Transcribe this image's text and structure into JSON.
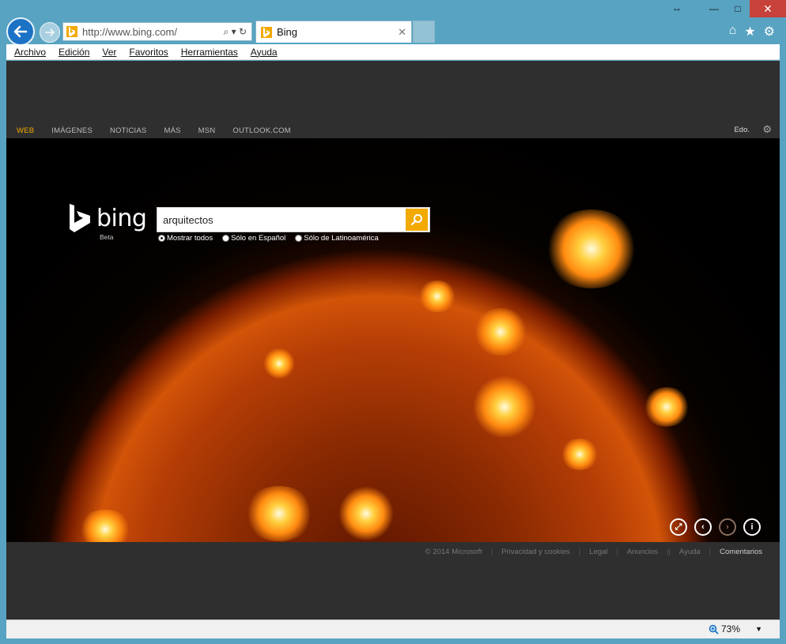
{
  "window": {
    "caption": {
      "resize": "↔",
      "minimize": "—",
      "maximize": "□",
      "close": "✕"
    }
  },
  "addressbar": {
    "url": "http://www.bing.com/",
    "tools": "⌕ ▾ ↻"
  },
  "tab": {
    "title": "Bing",
    "close": "✕"
  },
  "toolbar_icons": {
    "home": "⌂",
    "favorites": "★",
    "settings": "⚙"
  },
  "menu": [
    "Archivo",
    "Edición",
    "Ver",
    "Favoritos",
    "Herramientas",
    "Ayuda"
  ],
  "bing": {
    "nav": [
      "WEB",
      "IMÁGENES",
      "NOTICIAS",
      "MÁS",
      "MSN",
      "OUTLOOK.COM"
    ],
    "active_nav": "WEB",
    "account": "Edo.",
    "logo_word": "bing",
    "beta": "Beta",
    "search": {
      "value": "arquitectos"
    },
    "radios": [
      "Mostrar todos",
      "Sólo en Español",
      "Sólo de Latinoamérica"
    ],
    "selected_radio": "Mostrar todos",
    "footer": {
      "copyright": "© 2014 Microsoft",
      "privacy": "Privacidad y cookies",
      "legal": "Legal",
      "ads": "Anuncios",
      "help": "Ayuda",
      "feedback": "Comentarios",
      "sep1": "|",
      "sep2": "|",
      "sep3": "|",
      "sep4": "||",
      "sep5": "|"
    },
    "accent_color": "#f2a900"
  },
  "status": {
    "zoom": "73%"
  }
}
